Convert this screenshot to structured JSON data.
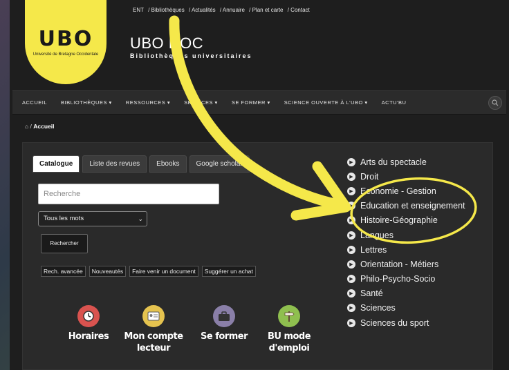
{
  "top_links": [
    "ENT",
    "/ Bibliothèques",
    "/ Actualités",
    "/ Annuaire",
    "/ Plan et carte",
    "/ Contact"
  ],
  "logo": {
    "mark": "UBO",
    "subtitle": "Université de Bretagne Occidentale"
  },
  "site": {
    "title": "UBO DOC",
    "subtitle": "Bibliothèques universitaires"
  },
  "nav": {
    "items": [
      "ACCUEIL",
      "BIBLIOTHÈQUES ▾",
      "RESSOURCES ▾",
      "SERVICES ▾",
      "SE FORMER ▾",
      "SCIENCE OUVERTE À L'UBO ▾",
      "ACTU'BU"
    ],
    "search_icon": "search-icon"
  },
  "breadcrumb": {
    "home_icon": "home-icon",
    "separator": "/",
    "current": "Accueil"
  },
  "search": {
    "tabs": [
      "Catalogue",
      "Liste des revues",
      "Ebooks",
      "Google scholar"
    ],
    "placeholder": "Recherche",
    "mode": "Tous les mots",
    "button": "Rechercher",
    "quick_links": [
      "Rech. avancée",
      "Nouveautés",
      "Faire venir un document",
      "Suggérer un achat"
    ]
  },
  "services": [
    {
      "label": "Horaires",
      "icon": "clock-icon",
      "color": "#d9534f"
    },
    {
      "label": "Mon compte lecteur",
      "icon": "id-card-icon",
      "color": "#e5c34f"
    },
    {
      "label": "Se former",
      "icon": "briefcase-icon",
      "color": "#8a7fa8"
    },
    {
      "label": "BU mode d'emploi",
      "icon": "signpost-icon",
      "color": "#8fbf4f"
    }
  ],
  "disciplines": [
    "Arts du spectacle",
    "Droit",
    "Economie - Gestion",
    "Education et enseignement",
    "Histoire-Géographie",
    "Langues",
    "Lettres",
    "Orientation - Métiers",
    "Philo-Psycho-Socio",
    "Santé",
    "Sciences",
    "Sciences du sport"
  ],
  "colors": {
    "annotation": "#f5e84a",
    "accent": "#f5e84a",
    "background": "#1e1e1e"
  }
}
